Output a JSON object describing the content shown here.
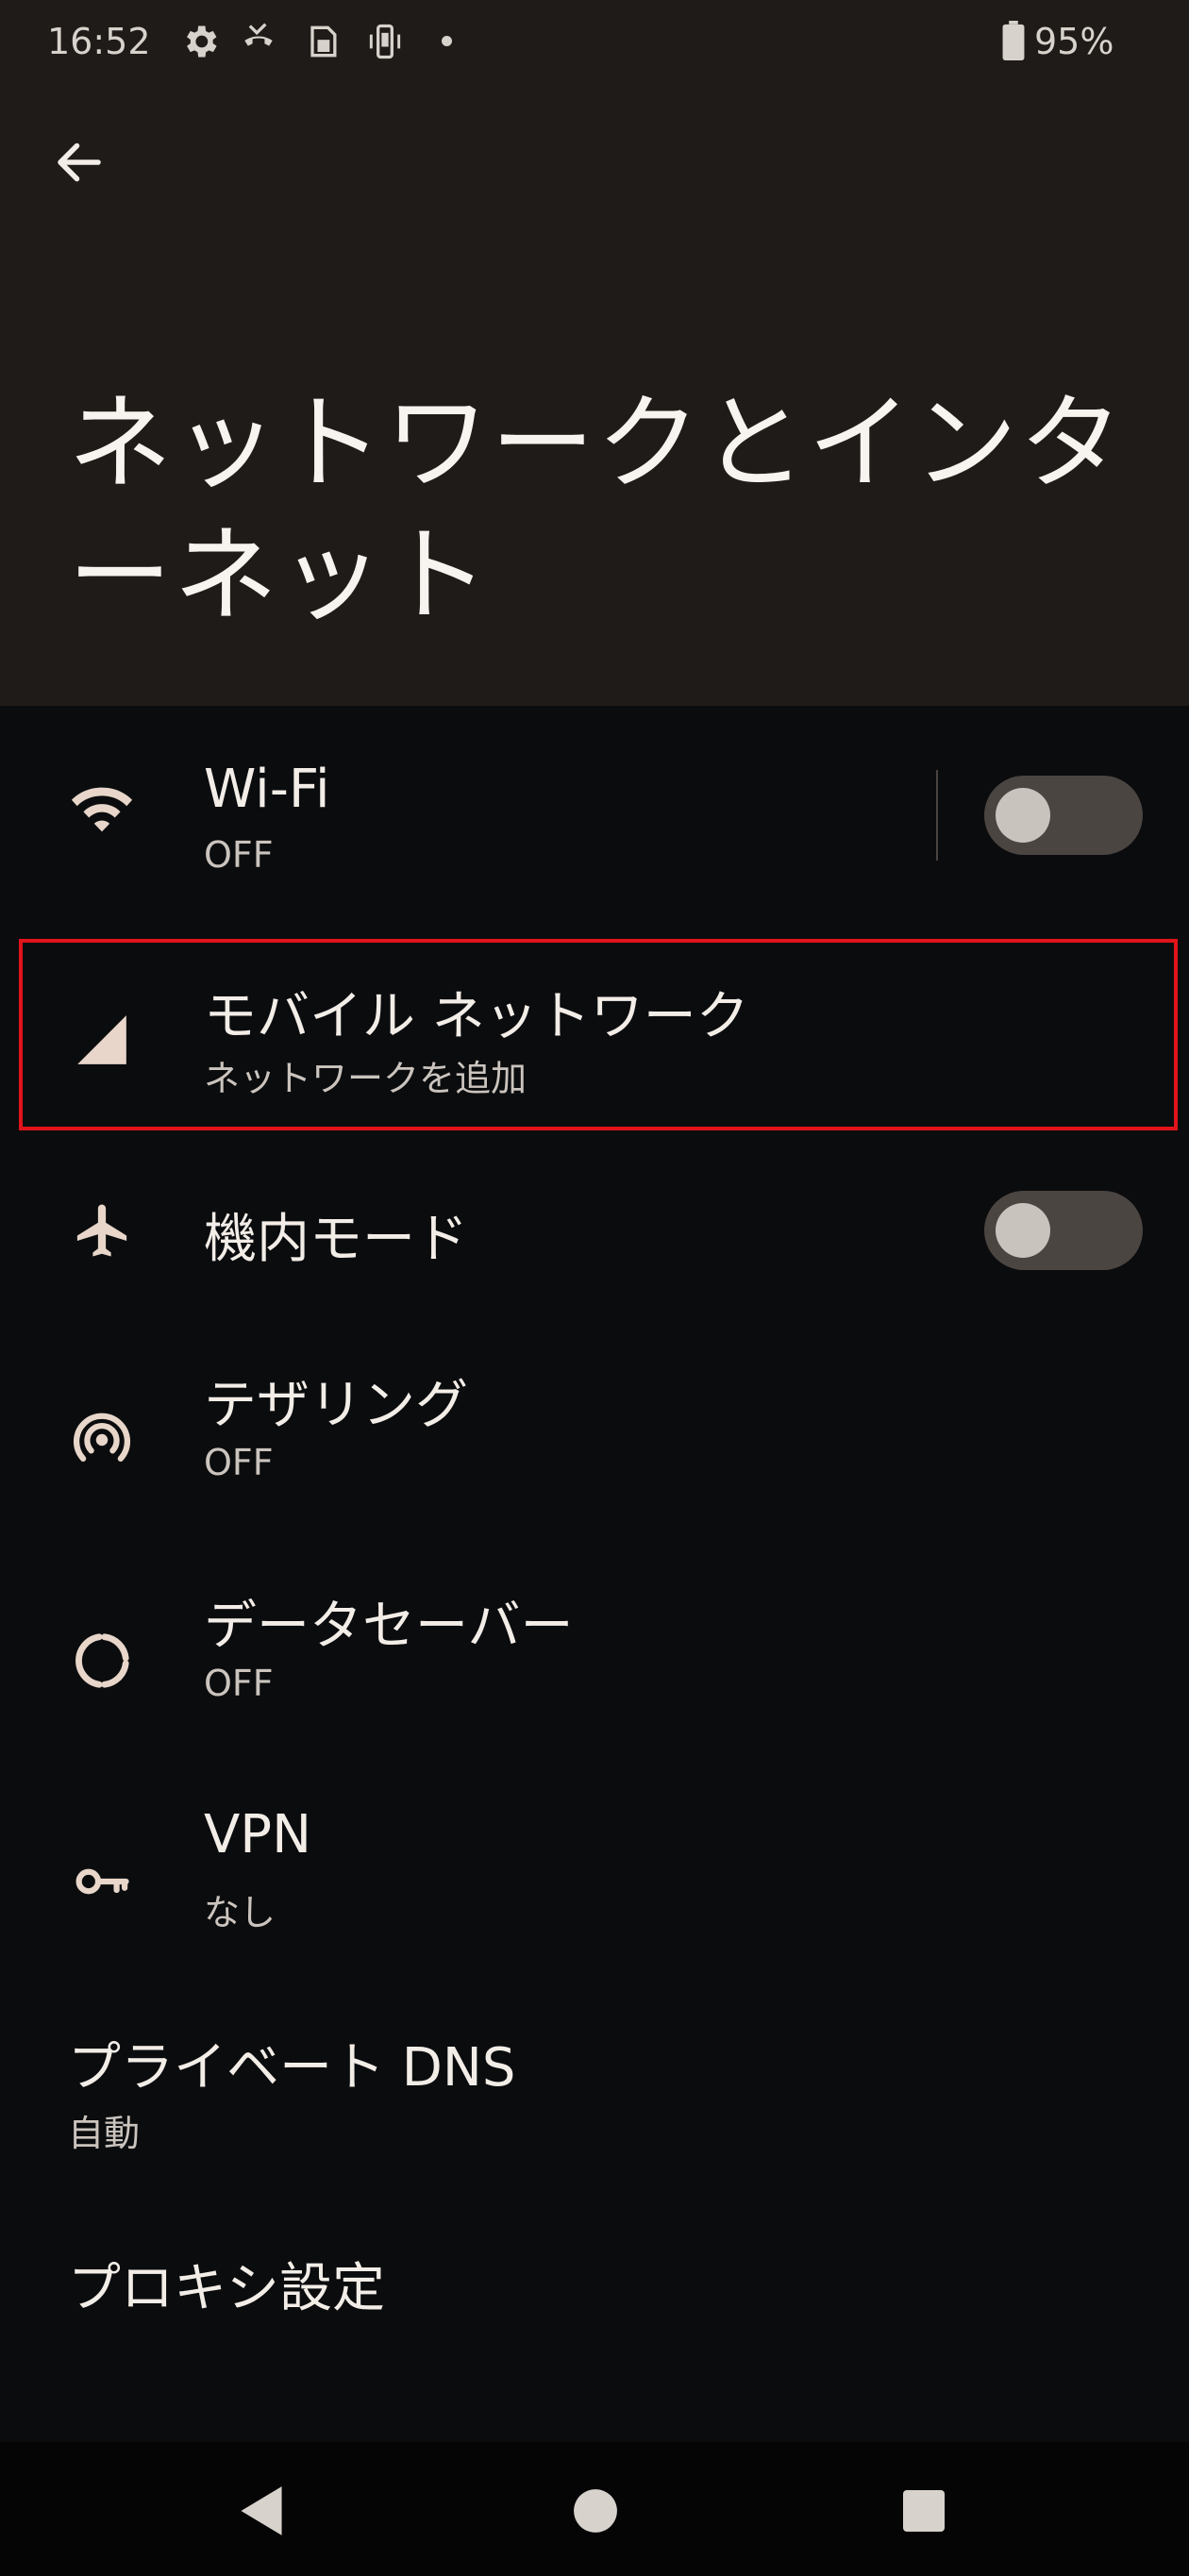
{
  "status_bar": {
    "time": "16:52",
    "battery": "95%",
    "icons": [
      "gear-icon",
      "call-forward-icon",
      "sim-card-icon",
      "phone-vibrate-icon",
      "dot-icon",
      "battery-icon"
    ]
  },
  "header": {
    "back_icon": "arrow-left-icon",
    "title": "ネットワークとインターネット"
  },
  "items": {
    "wifi": {
      "title": "Wi-Fi",
      "subtitle": "OFF",
      "icon": "wifi-icon",
      "toggle": false
    },
    "mobile": {
      "title": "モバイル ネットワーク",
      "subtitle": "ネットワークを追加",
      "icon": "signal-icon"
    },
    "airplane": {
      "title": "機内モード",
      "icon": "airplane-icon",
      "toggle": false
    },
    "tethering": {
      "title": "テザリング",
      "subtitle": "OFF",
      "icon": "hotspot-icon"
    },
    "datasaver": {
      "title": "データセーバー",
      "subtitle": "OFF",
      "icon": "data-saver-icon"
    },
    "vpn": {
      "title": "VPN",
      "subtitle": "なし",
      "icon": "key-icon"
    },
    "private_dns": {
      "title": "プライベート DNS",
      "subtitle": "自動"
    },
    "proxy": {
      "title": "プロキシ設定"
    }
  },
  "nav_bar": {
    "icons": [
      "back-triangle-icon",
      "home-circle-icon",
      "recents-square-icon"
    ]
  },
  "colors": {
    "header_bg": "#1f1b18",
    "body_bg": "#0b0c0e",
    "accent_icon": "#e7d6c9",
    "toggle_off_track": "#4b4542",
    "highlight": "#e0141a"
  }
}
